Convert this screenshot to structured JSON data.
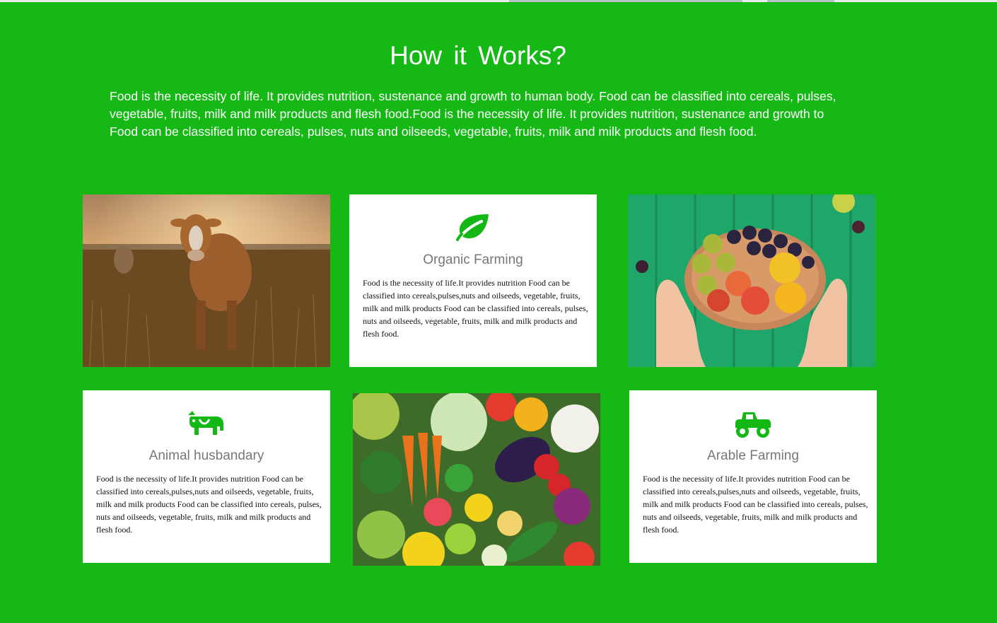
{
  "section": {
    "title": "How  it  Works?",
    "intro": "Food is the necessity of life. It provides nutrition, sustenance and growth to human body. Food can be classified into cereals, pulses, vegetable, fruits, milk and milk products and flesh food.Food is the necessity of life. It provides nutrition, sustenance and growth to Food can be classified into cereals, pulses, nuts and oilseeds, vegetable, fruits, milk and milk products and flesh food."
  },
  "cards": [
    {
      "icon": "leaf-icon",
      "title": "Organic Farming",
      "text": "Food is the necessity of life.It provides nutrition Food can be classified into cereals,pulses,nuts and oilseeds, vegetable, fruits, milk and milk products Food can be classified into cereals, pulses, nuts and oilseeds, vegetable, fruits, milk and milk products and flesh food."
    },
    {
      "icon": "cow-icon",
      "title": "Animal husbandary",
      "text": "Food is the necessity of life.It provides nutrition Food can be classified into cereals,pulses,nuts and oilseeds, vegetable, fruits, milk and milk products Food can be classified into cereals, pulses, nuts and oilseeds, vegetable, fruits, milk and milk products and flesh food."
    },
    {
      "icon": "tractor-icon",
      "title": "Arable Farming",
      "text": "Food is the necessity of life.It provides nutrition Food can be classified into cereals,pulses,nuts and oilseeds, vegetable, fruits, milk and milk products Food can be classified into cereals, pulses, nuts and oilseeds, vegetable, fruits, milk and milk products and flesh food."
    }
  ],
  "images": {
    "cow_photo": "cow in field photo",
    "fruit_photo": "hands holding fruit plate photo",
    "vegetables_photo": "assorted vegetables photo"
  },
  "colors": {
    "background": "#15b815",
    "accent": "#14b814",
    "card": "#ffffff"
  }
}
